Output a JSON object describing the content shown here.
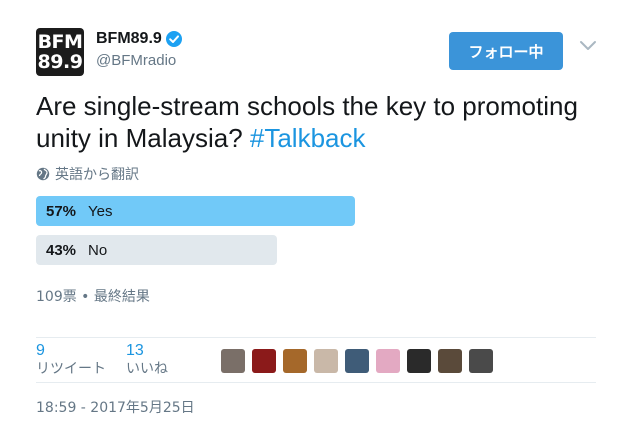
{
  "header": {
    "avatar_line1": "BFM",
    "avatar_line2": "89.9",
    "display_name": "BFM89.9",
    "handle": "@BFMradio",
    "follow_label": "フォロー中"
  },
  "tweet": {
    "text_main": "Are single-stream schools the key to promoting unity in Malaysia? ",
    "hashtag": "#Talkback",
    "translate_label": "英語から翻訳"
  },
  "poll": {
    "options": [
      {
        "percent": "57%",
        "label": "Yes",
        "value": 57
      },
      {
        "percent": "43%",
        "label": "No",
        "value": 43
      }
    ],
    "meta": "109票 • 最終結果"
  },
  "stats": {
    "retweets_count": "9",
    "retweets_label": "リツイート",
    "likes_count": "13",
    "likes_label": "いいね"
  },
  "likers": [
    "#7a6f68",
    "#8b1a1a",
    "#a5682a",
    "#c9b8a8",
    "#3f5c78",
    "#e3a9c2",
    "#2a2a2a",
    "#5a4a3a",
    "#4a4a4a"
  ],
  "timestamp": "18:59 - 2017年5月25日",
  "colors": {
    "accent": "#1da1f2",
    "link": "#1b95e0",
    "follow_bg": "#3b94d9",
    "winner_bar": "#71c9f8",
    "loser_bar": "#e1e8ed"
  }
}
